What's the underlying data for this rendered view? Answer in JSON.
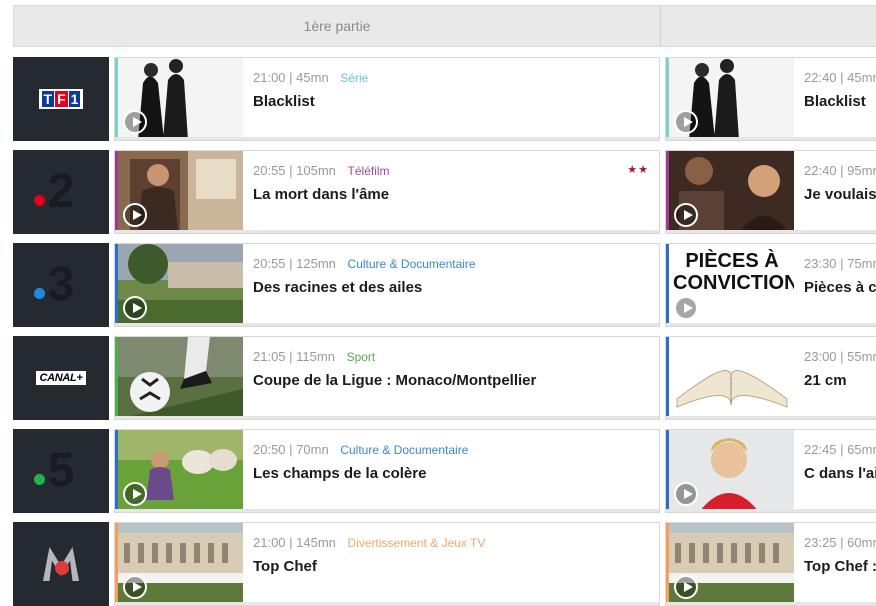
{
  "header": {
    "part1": "1ère partie"
  },
  "rows": [
    {
      "channel": {
        "name": "TF1",
        "logo": "tf1-logo",
        "text": "TF1"
      },
      "first": {
        "time": "21:00",
        "duration": "| 45mn",
        "genre": "Série",
        "title": "Blacklist",
        "accent": "#7ecfd0",
        "genre_color": "#6ec5d5"
      },
      "second": {
        "time": "22:40",
        "duration": "| 45mn",
        "title": "Blacklist",
        "accent": "#7ecfd0"
      }
    },
    {
      "channel": {
        "name": "France 2",
        "logo": "france2-logo",
        "text": "2",
        "dot": "#e2001a"
      },
      "first": {
        "time": "20:55",
        "duration": "| 105mn",
        "genre": "Téléfilm",
        "title": "La mort dans l'âme",
        "accent": "#9b3a8f",
        "genre_color": "#a04b9a",
        "stars": "★★"
      },
      "second": {
        "time": "22:40",
        "duration": "| 95mn",
        "title": "Je voulais",
        "accent": "#9b3a8f"
      }
    },
    {
      "channel": {
        "name": "France 3",
        "logo": "france3-logo",
        "text": "3",
        "dot": "#1e88e5"
      },
      "first": {
        "time": "20:55",
        "duration": "| 125mn",
        "genre": "Culture & Documentaire",
        "title": "Des racines et des ailes",
        "accent": "#2c6fc6",
        "genre_color": "#3a87cf"
      },
      "second": {
        "time": "23:30",
        "duration": "| 75mn",
        "title": "Pièces à c",
        "accent": "#2c6fc6",
        "thumb_text": "PIÈCES À CONVICTION"
      }
    },
    {
      "channel": {
        "name": "Canal+",
        "logo": "canalplus-logo",
        "text": "CANAL+"
      },
      "first": {
        "time": "21:05",
        "duration": "| 115mn",
        "genre": "Sport",
        "title": "Coupe de la Ligue : Monaco/Montpellier",
        "accent": "#4caf50",
        "genre_color": "#5aa55a"
      },
      "second": {
        "time": "23:00",
        "duration": "| 55mn",
        "title": "21 cm",
        "accent": "#2c6fc6"
      }
    },
    {
      "channel": {
        "name": "France 5",
        "logo": "france5-logo",
        "text": "5",
        "dot": "#21b24b"
      },
      "first": {
        "time": "20:50",
        "duration": "| 70mn",
        "genre": "Culture & Documentaire",
        "title": "Les champs de la colère",
        "accent": "#2c6fc6",
        "genre_color": "#3a87cf"
      },
      "second": {
        "time": "22:45",
        "duration": "| 65mn",
        "title": "C dans l'ai",
        "accent": "#2c6fc6"
      }
    },
    {
      "channel": {
        "name": "M6",
        "logo": "m6-logo",
        "text": "M6"
      },
      "first": {
        "time": "21:00",
        "duration": "| 145mn",
        "genre": "Divertissement & Jeux TV",
        "title": "Top Chef",
        "accent": "#f5a05a",
        "genre_color": "#f2a66a"
      },
      "second": {
        "time": "23:25",
        "duration": "| 60mn",
        "title": "Top Chef :",
        "accent": "#f5a05a"
      }
    }
  ]
}
